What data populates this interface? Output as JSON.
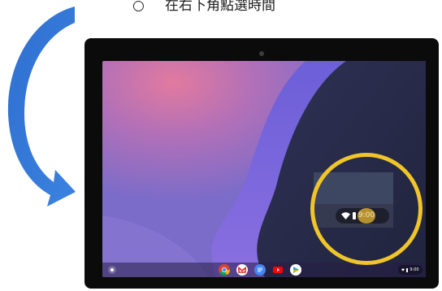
{
  "instruction": {
    "bullet": "○",
    "text": "在右下角點選時間"
  },
  "colors": {
    "arrow": "#2e73d3",
    "highlight_ring": "#f0c52a",
    "tablet_bezel": "#0b0b0b"
  },
  "icons": {
    "launcher": "launcher-circle-icon",
    "apps": [
      "chrome-icon",
      "gmail-icon",
      "docs-icon",
      "youtube-icon",
      "play-store-icon"
    ],
    "wifi": "wifi-icon",
    "battery": "battery-icon"
  },
  "shelf": {
    "time": "9:00"
  },
  "zoomed_tray": {
    "time": "9:00"
  }
}
